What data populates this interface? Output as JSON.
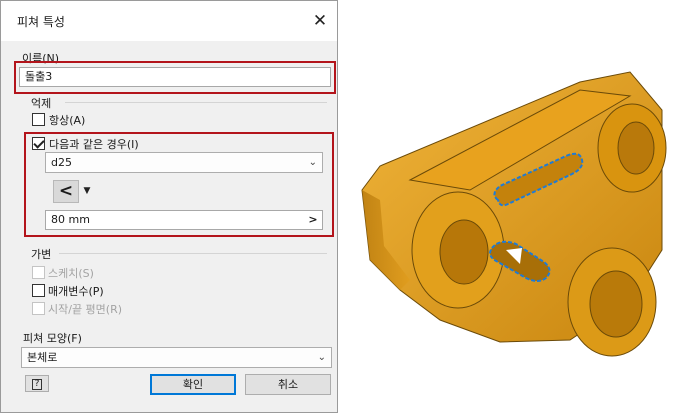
{
  "dialog": {
    "title": "피쳐 특성",
    "name_label": "이름(N)",
    "name_value": "돌출3",
    "suppress_group_label": "억제",
    "always_label": "항상(A)",
    "if_label": "다음과 같은 경우(I)",
    "parameter_value": "d25",
    "operator": "<",
    "threshold_value": "80 mm",
    "adaptive_group_label": "가변",
    "sketch_label": "스케치(S)",
    "parameters_label": "매개변수(P)",
    "start_end_plane_label": "시작/끝 평면(R)",
    "appearance_label": "피쳐 모양(F)",
    "appearance_value": "본체로",
    "ok_label": "확인",
    "cancel_label": "취소"
  },
  "colors": {
    "highlight_border": "#b3141b",
    "part_body": "#e4a11b",
    "selected_edge": "#1e7bd6"
  },
  "icons": {
    "close": "close-icon",
    "help": "help-icon",
    "dropdown": "chevron-down-icon",
    "expand": "chevron-right-icon"
  }
}
